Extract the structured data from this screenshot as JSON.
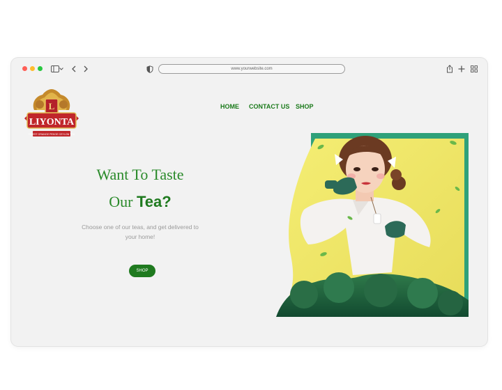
{
  "browser": {
    "url": "www.yourwebsite.com"
  },
  "logo": {
    "brand": "LIYONTA",
    "monogram": "L",
    "tagline": "FINEST ORANGE PEKOE CEYLON TEA"
  },
  "nav": {
    "home": "HOME",
    "contact": "CONTACT US",
    "shop": "SHOP"
  },
  "hero": {
    "headline_line1": "Want To Taste",
    "headline_our": "Our ",
    "headline_tea": "Tea?",
    "subtitle": "Choose one of our teas, and get delivered to your home!",
    "cta": "SHOP"
  },
  "colors": {
    "accent_green": "#1f7a1f",
    "teal": "#2fa17a",
    "yellow": "#f1e86a",
    "logo_red": "#c0262b",
    "logo_gold": "#d8a838"
  }
}
